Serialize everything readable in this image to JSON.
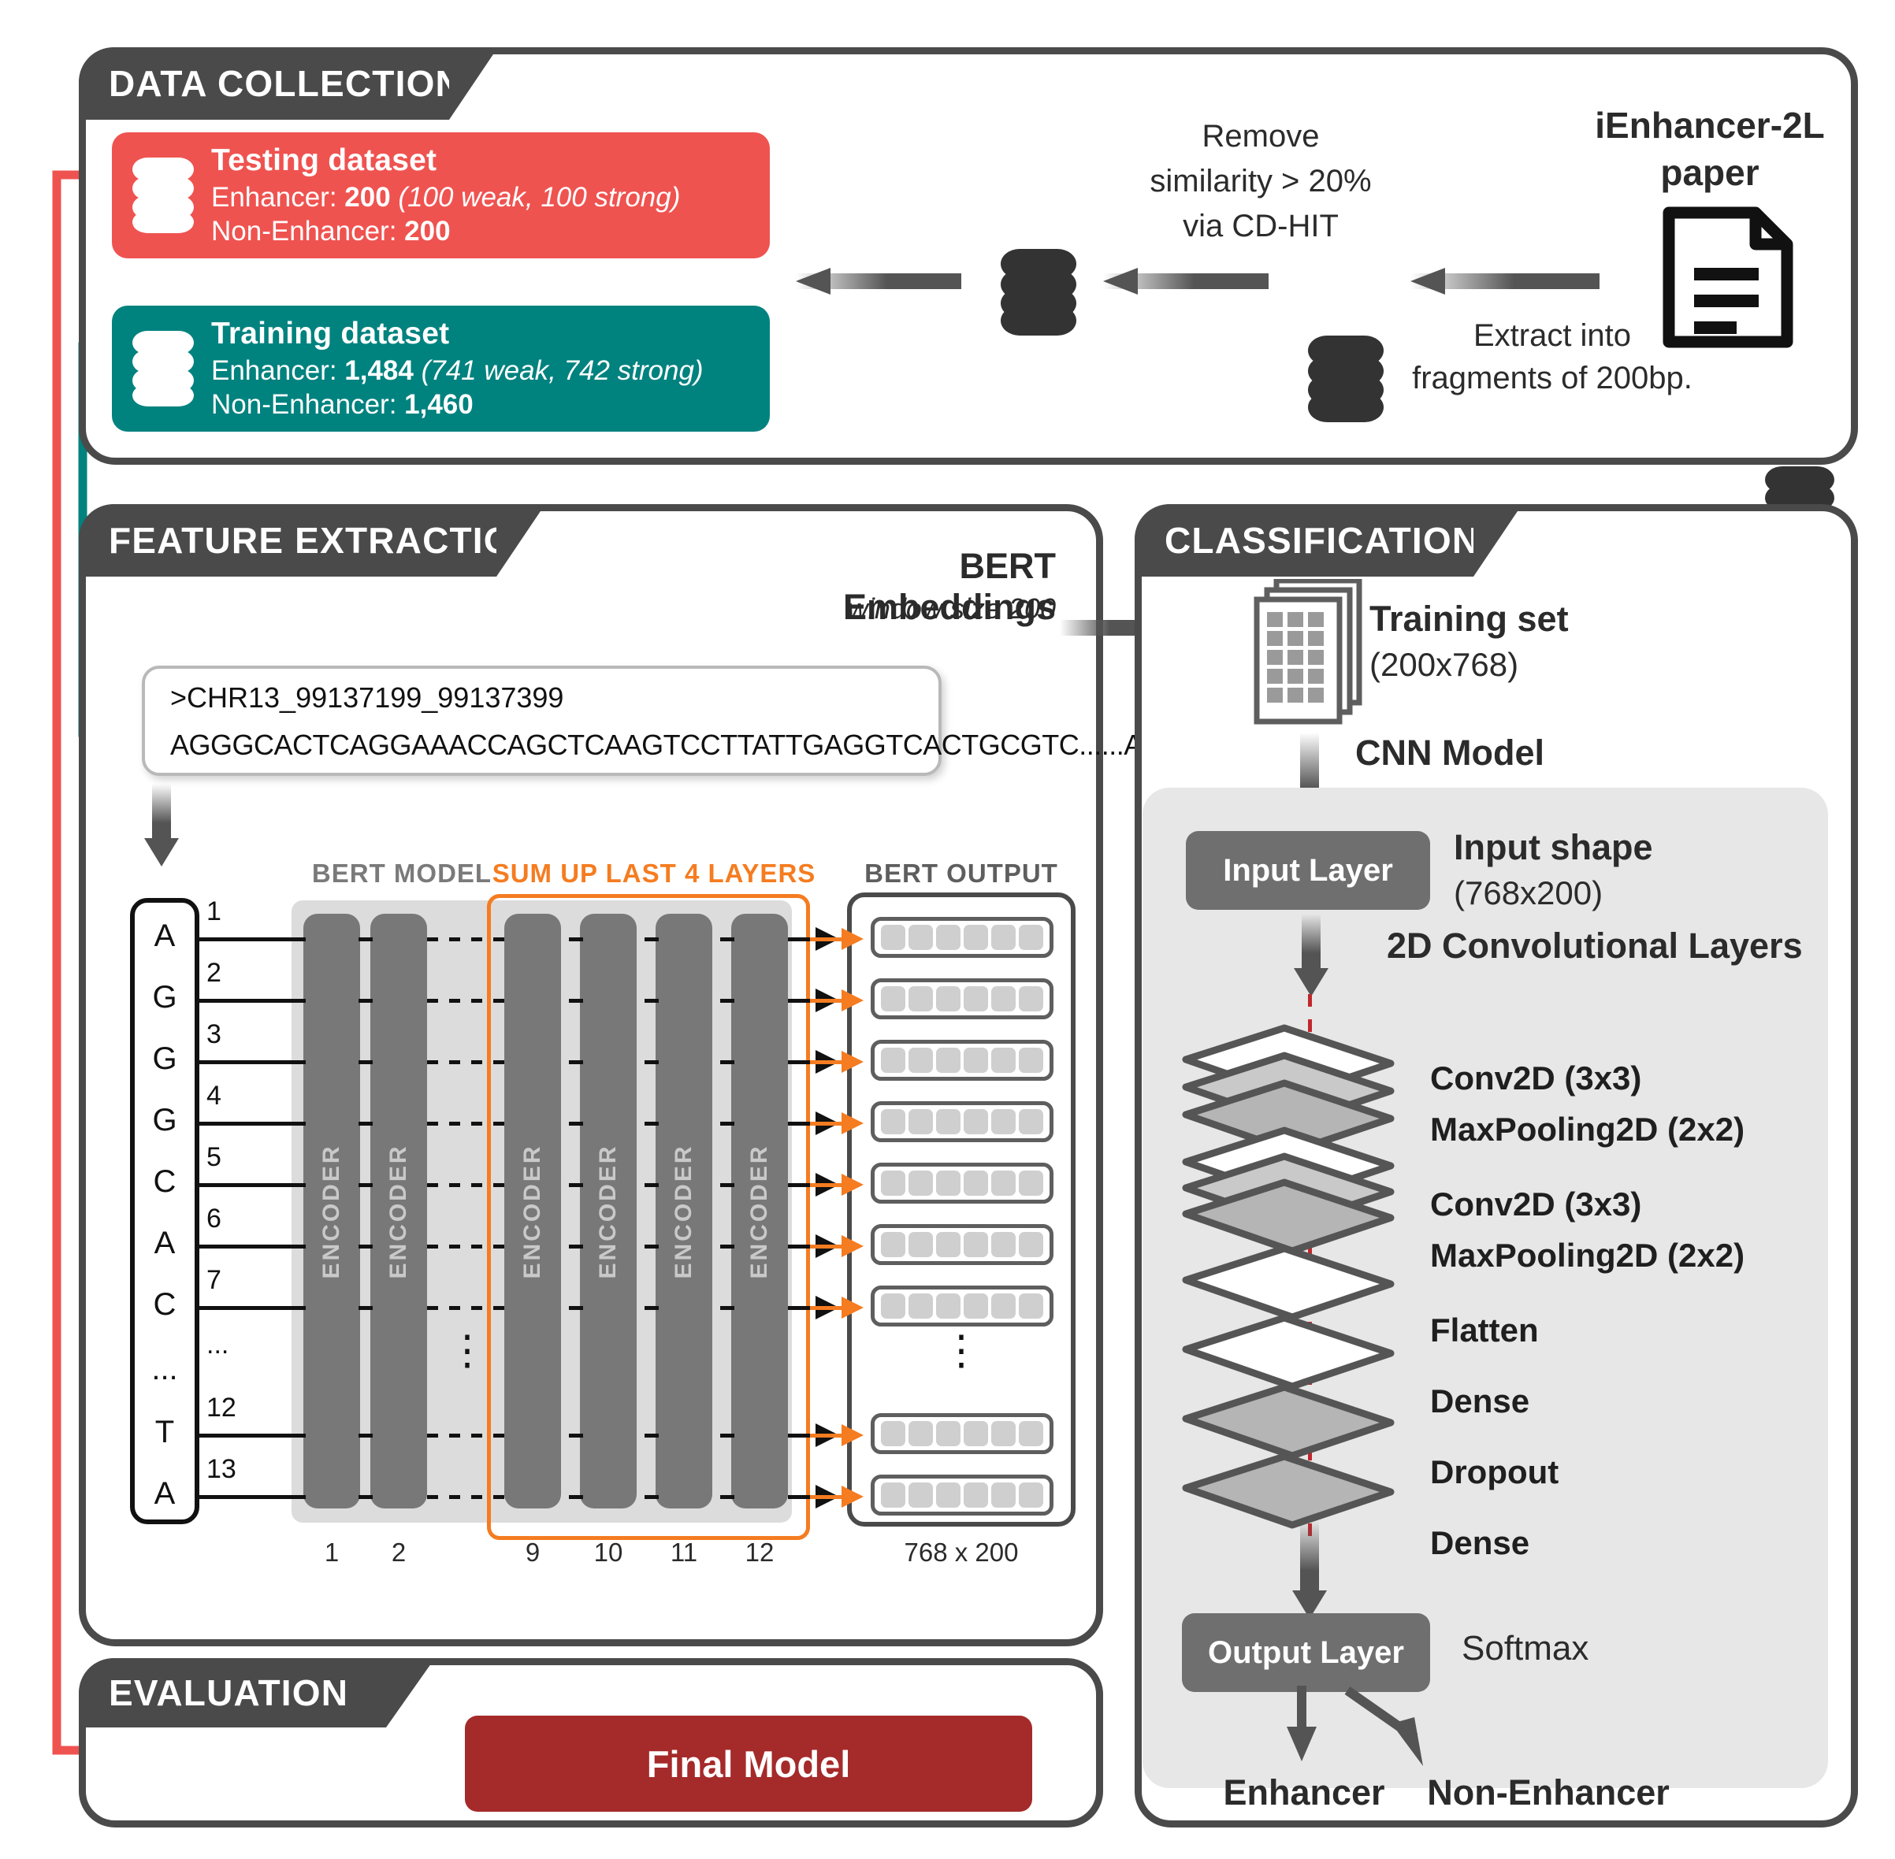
{
  "sections": {
    "data_collection": "DATA COLLECTION",
    "feature_extraction": "FEATURE EXTRACTION",
    "classification": "CLASSIFICATION",
    "evaluation": "EVALUATION"
  },
  "colors": {
    "testing": "#EF5350",
    "training": "#00827F",
    "final_model": "#A52A2A",
    "panel_border": "#4a4a4a",
    "orange": "#F57C20",
    "red_dash": "#C1272D"
  },
  "data_collection": {
    "testing": {
      "title": "Testing dataset",
      "enhancer_label": "Enhancer: ",
      "enhancer_count": "200",
      "enhancer_note": " (100 weak, 100 strong)",
      "non_enhancer_label": "Non-Enhancer: ",
      "non_enhancer_count": "200"
    },
    "training": {
      "title": "Training dataset",
      "enhancer_label": "Enhancer: ",
      "enhancer_count": "1,484",
      "enhancer_note": " (741 weak, 742 strong)",
      "non_enhancer_label": "Non-Enhancer: ",
      "non_enhancer_count": "1,460"
    },
    "cdhit_note": "Remove\nsimilarity > 20%\nvia CD-HIT",
    "cdhit_line1": "Remove",
    "cdhit_line2": "similarity > 20%",
    "cdhit_line3": "via CD-HIT",
    "paper_title_line1": "iEnhancer-2L",
    "paper_title_line2": "paper",
    "extract_line1": "Extract into",
    "extract_line2": "fragments of 200bp."
  },
  "feature_extraction": {
    "bert_embeddings_title": "BERT Embeddings",
    "bert_embeddings_sub": "window size 200",
    "fasta_header": ">CHR13_99137199_99137399",
    "fasta_sequence": "AGGGCACTCAGGAAACCAGCTCAAGTCCTTATTGAGGTCACTGCGTC......AATA",
    "bert_model_caption": "BERT MODEL",
    "sum_caption": "SUM UP LAST 4 LAYERS",
    "bert_output_caption": "BERT OUTPUT",
    "encoder_label": "ENCODER",
    "output_dims": "768 x 200",
    "nucleotides": [
      "A",
      "G",
      "G",
      "G",
      "C",
      "A",
      "C",
      "...",
      "T",
      "A"
    ],
    "indices": [
      "1",
      "2",
      "3",
      "4",
      "5",
      "6",
      "7",
      "...",
      "12",
      "13"
    ],
    "encoder_numbers_left": [
      "1",
      "2"
    ],
    "encoder_numbers_right": [
      "9",
      "10",
      "11",
      "12"
    ],
    "ellipsis": "⋮"
  },
  "classification": {
    "training_set_title": "Training set",
    "training_set_shape": "(200x768)",
    "cnn_model_title": "CNN Model",
    "input_layer": "Input Layer",
    "input_shape_title": "Input shape",
    "input_shape_value": "(768x200)",
    "conv_layers_title": "2D Convolutional Layers",
    "layers": [
      {
        "name": "Conv2D (3x3)"
      },
      {
        "name": "MaxPooling2D (2x2)"
      },
      {
        "name": "Conv2D (3x3)"
      },
      {
        "name": "MaxPooling2D (2x2)"
      },
      {
        "name": "Flatten"
      },
      {
        "name": "Dense"
      },
      {
        "name": "Dropout"
      },
      {
        "name": "Dense"
      }
    ],
    "output_layer": "Output Layer",
    "softmax": "Softmax",
    "class_enhancer": "Enhancer",
    "class_non_enhancer": "Non-Enhancer"
  },
  "evaluation": {
    "final_model": "Final Model"
  }
}
